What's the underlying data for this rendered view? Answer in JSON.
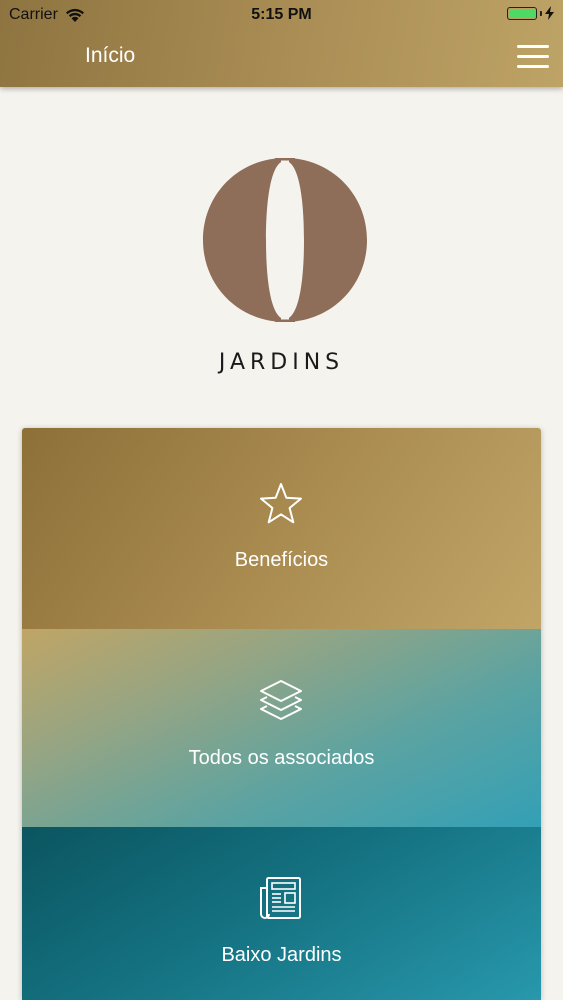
{
  "status_bar": {
    "carrier": "Carrier",
    "time": "5:15 PM",
    "battery_level": 1.0
  },
  "header": {
    "title": "Início",
    "menu_icon": "hamburger-menu-icon"
  },
  "brand": {
    "name": "JARDINS",
    "logo_color": "#8e6e59"
  },
  "cards": [
    {
      "label": "Benefícios",
      "icon": "star-icon"
    },
    {
      "label": "Todos os associados",
      "icon": "layers-icon"
    },
    {
      "label": "Baixo Jardins",
      "icon": "newspaper-icon"
    }
  ],
  "colors": {
    "gold": "#a98b50",
    "teal": "#2898ac",
    "background": "#f5f3ee"
  }
}
